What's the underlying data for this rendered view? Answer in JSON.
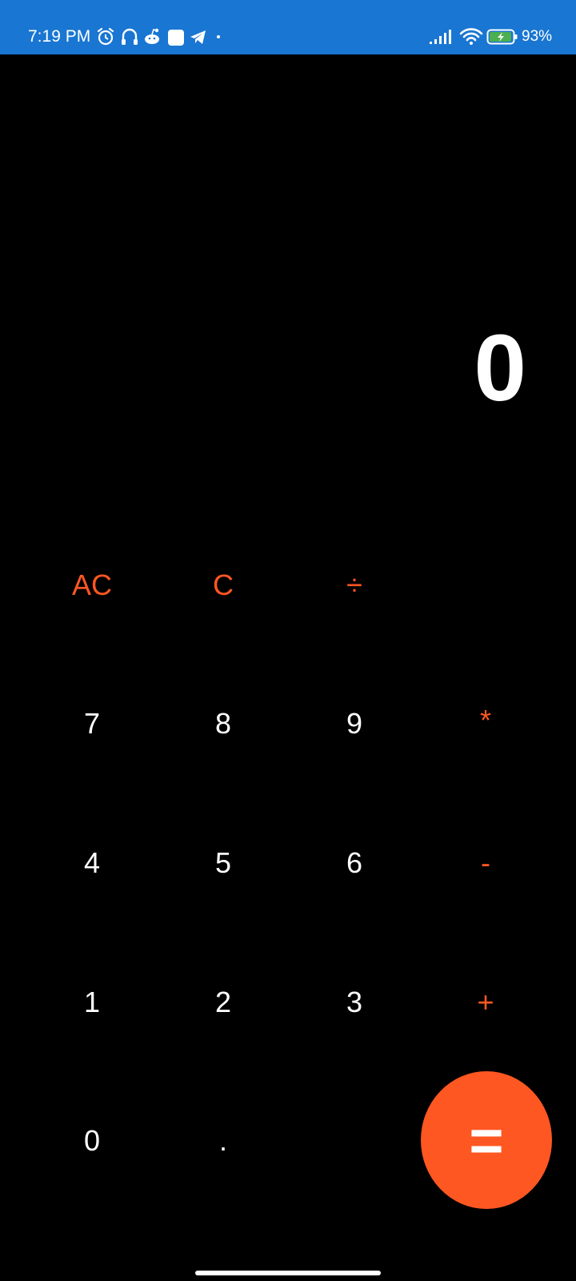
{
  "status_bar": {
    "time": "7:19 PM",
    "battery_percent": "93%",
    "icons_left": [
      "alarm-icon",
      "headphones-icon",
      "reddit-icon",
      "app-square-icon",
      "telegram-icon",
      "dot-icon"
    ],
    "icons_right": [
      "signal-icon",
      "wifi-icon",
      "battery-charging-icon"
    ],
    "background": "#1976D2"
  },
  "display": {
    "value": "0"
  },
  "keypad": {
    "row1": [
      "AC",
      "C",
      "÷"
    ],
    "row2": [
      "7",
      "8",
      "9",
      "*"
    ],
    "row3": [
      "4",
      "5",
      "6",
      "-"
    ],
    "row4": [
      "1",
      "2",
      "3",
      "+"
    ],
    "row5": [
      "0",
      ".",
      "="
    ]
  },
  "colors": {
    "accent": "#FF5722",
    "background": "#000000",
    "text": "#FFFFFF"
  }
}
